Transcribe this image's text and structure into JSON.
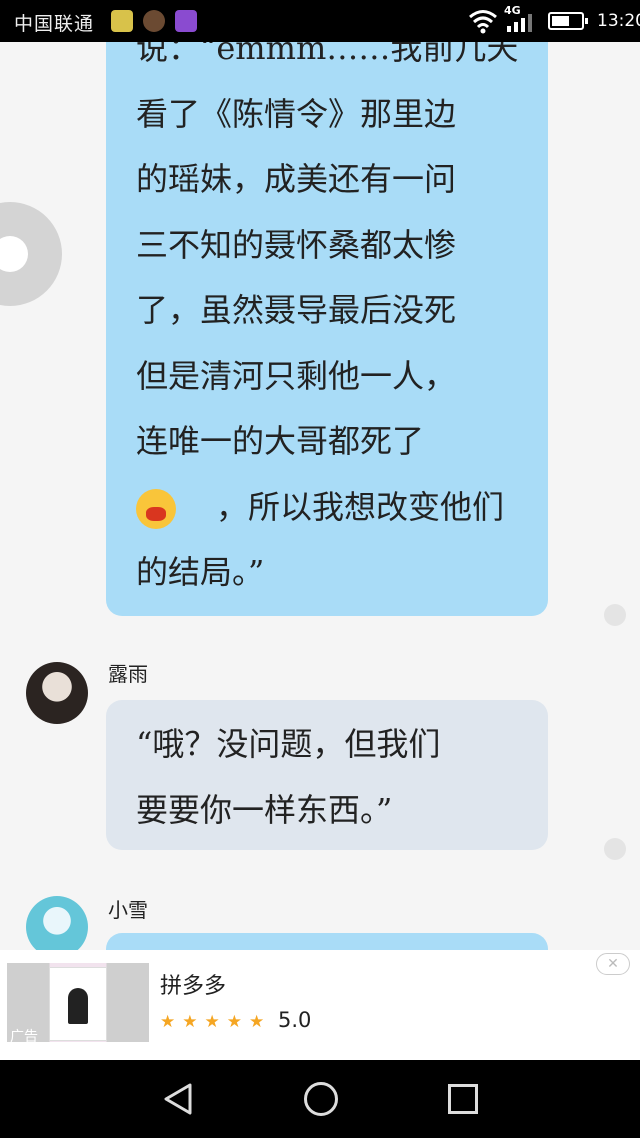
{
  "status_bar": {
    "carrier": "中国联通",
    "network": "4G",
    "time": "13:20",
    "battery_level": 0.6
  },
  "messages": [
    {
      "lines": [
        "说：“emmm……我前几天",
        "看了《陈情令》那里边",
        "的瑶妹，成美还有一问",
        "三不知的聂怀桑都太惨",
        "了，虽然聂导最后没死",
        "但是清河只剩他一人，",
        "连唯一的大哥都死了",
        "，所以我想改变他们",
        "的结局。”"
      ],
      "emoji": "crying-face"
    },
    {
      "sender": "露雨",
      "lines": [
        "“哦？没问题，但我们",
        "要要你一样东西。”"
      ]
    },
    {
      "sender": "小雪",
      "lines": []
    }
  ],
  "ad": {
    "tag": "广告",
    "title": "拼多多",
    "rating": "5.0",
    "stars": "★★★★★",
    "close": "✕"
  },
  "colors": {
    "my_bubble": "#a9dcf7",
    "other_bubble": "#dfe6ee",
    "star": "#f5a623"
  }
}
